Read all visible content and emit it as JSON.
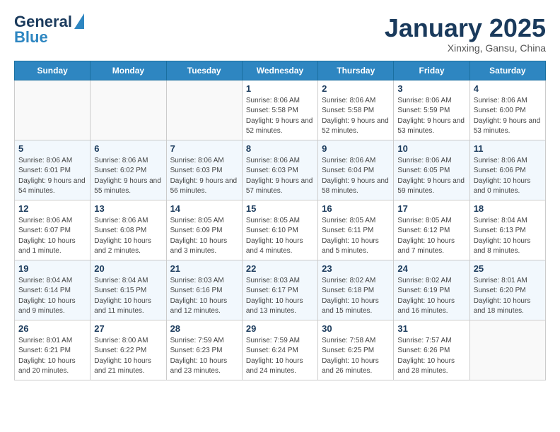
{
  "header": {
    "logo_line1": "General",
    "logo_line2": "Blue",
    "month_year": "January 2025",
    "location": "Xinxing, Gansu, China"
  },
  "days_of_week": [
    "Sunday",
    "Monday",
    "Tuesday",
    "Wednesday",
    "Thursday",
    "Friday",
    "Saturday"
  ],
  "weeks": [
    {
      "alt": false,
      "days": [
        {
          "num": "",
          "info": ""
        },
        {
          "num": "",
          "info": ""
        },
        {
          "num": "",
          "info": ""
        },
        {
          "num": "1",
          "info": "Sunrise: 8:06 AM\nSunset: 5:58 PM\nDaylight: 9 hours and 52 minutes."
        },
        {
          "num": "2",
          "info": "Sunrise: 8:06 AM\nSunset: 5:58 PM\nDaylight: 9 hours and 52 minutes."
        },
        {
          "num": "3",
          "info": "Sunrise: 8:06 AM\nSunset: 5:59 PM\nDaylight: 9 hours and 53 minutes."
        },
        {
          "num": "4",
          "info": "Sunrise: 8:06 AM\nSunset: 6:00 PM\nDaylight: 9 hours and 53 minutes."
        }
      ]
    },
    {
      "alt": true,
      "days": [
        {
          "num": "5",
          "info": "Sunrise: 8:06 AM\nSunset: 6:01 PM\nDaylight: 9 hours and 54 minutes."
        },
        {
          "num": "6",
          "info": "Sunrise: 8:06 AM\nSunset: 6:02 PM\nDaylight: 9 hours and 55 minutes."
        },
        {
          "num": "7",
          "info": "Sunrise: 8:06 AM\nSunset: 6:03 PM\nDaylight: 9 hours and 56 minutes."
        },
        {
          "num": "8",
          "info": "Sunrise: 8:06 AM\nSunset: 6:03 PM\nDaylight: 9 hours and 57 minutes."
        },
        {
          "num": "9",
          "info": "Sunrise: 8:06 AM\nSunset: 6:04 PM\nDaylight: 9 hours and 58 minutes."
        },
        {
          "num": "10",
          "info": "Sunrise: 8:06 AM\nSunset: 6:05 PM\nDaylight: 9 hours and 59 minutes."
        },
        {
          "num": "11",
          "info": "Sunrise: 8:06 AM\nSunset: 6:06 PM\nDaylight: 10 hours and 0 minutes."
        }
      ]
    },
    {
      "alt": false,
      "days": [
        {
          "num": "12",
          "info": "Sunrise: 8:06 AM\nSunset: 6:07 PM\nDaylight: 10 hours and 1 minute."
        },
        {
          "num": "13",
          "info": "Sunrise: 8:06 AM\nSunset: 6:08 PM\nDaylight: 10 hours and 2 minutes."
        },
        {
          "num": "14",
          "info": "Sunrise: 8:05 AM\nSunset: 6:09 PM\nDaylight: 10 hours and 3 minutes."
        },
        {
          "num": "15",
          "info": "Sunrise: 8:05 AM\nSunset: 6:10 PM\nDaylight: 10 hours and 4 minutes."
        },
        {
          "num": "16",
          "info": "Sunrise: 8:05 AM\nSunset: 6:11 PM\nDaylight: 10 hours and 5 minutes."
        },
        {
          "num": "17",
          "info": "Sunrise: 8:05 AM\nSunset: 6:12 PM\nDaylight: 10 hours and 7 minutes."
        },
        {
          "num": "18",
          "info": "Sunrise: 8:04 AM\nSunset: 6:13 PM\nDaylight: 10 hours and 8 minutes."
        }
      ]
    },
    {
      "alt": true,
      "days": [
        {
          "num": "19",
          "info": "Sunrise: 8:04 AM\nSunset: 6:14 PM\nDaylight: 10 hours and 9 minutes."
        },
        {
          "num": "20",
          "info": "Sunrise: 8:04 AM\nSunset: 6:15 PM\nDaylight: 10 hours and 11 minutes."
        },
        {
          "num": "21",
          "info": "Sunrise: 8:03 AM\nSunset: 6:16 PM\nDaylight: 10 hours and 12 minutes."
        },
        {
          "num": "22",
          "info": "Sunrise: 8:03 AM\nSunset: 6:17 PM\nDaylight: 10 hours and 13 minutes."
        },
        {
          "num": "23",
          "info": "Sunrise: 8:02 AM\nSunset: 6:18 PM\nDaylight: 10 hours and 15 minutes."
        },
        {
          "num": "24",
          "info": "Sunrise: 8:02 AM\nSunset: 6:19 PM\nDaylight: 10 hours and 16 minutes."
        },
        {
          "num": "25",
          "info": "Sunrise: 8:01 AM\nSunset: 6:20 PM\nDaylight: 10 hours and 18 minutes."
        }
      ]
    },
    {
      "alt": false,
      "days": [
        {
          "num": "26",
          "info": "Sunrise: 8:01 AM\nSunset: 6:21 PM\nDaylight: 10 hours and 20 minutes."
        },
        {
          "num": "27",
          "info": "Sunrise: 8:00 AM\nSunset: 6:22 PM\nDaylight: 10 hours and 21 minutes."
        },
        {
          "num": "28",
          "info": "Sunrise: 7:59 AM\nSunset: 6:23 PM\nDaylight: 10 hours and 23 minutes."
        },
        {
          "num": "29",
          "info": "Sunrise: 7:59 AM\nSunset: 6:24 PM\nDaylight: 10 hours and 24 minutes."
        },
        {
          "num": "30",
          "info": "Sunrise: 7:58 AM\nSunset: 6:25 PM\nDaylight: 10 hours and 26 minutes."
        },
        {
          "num": "31",
          "info": "Sunrise: 7:57 AM\nSunset: 6:26 PM\nDaylight: 10 hours and 28 minutes."
        },
        {
          "num": "",
          "info": ""
        }
      ]
    }
  ]
}
